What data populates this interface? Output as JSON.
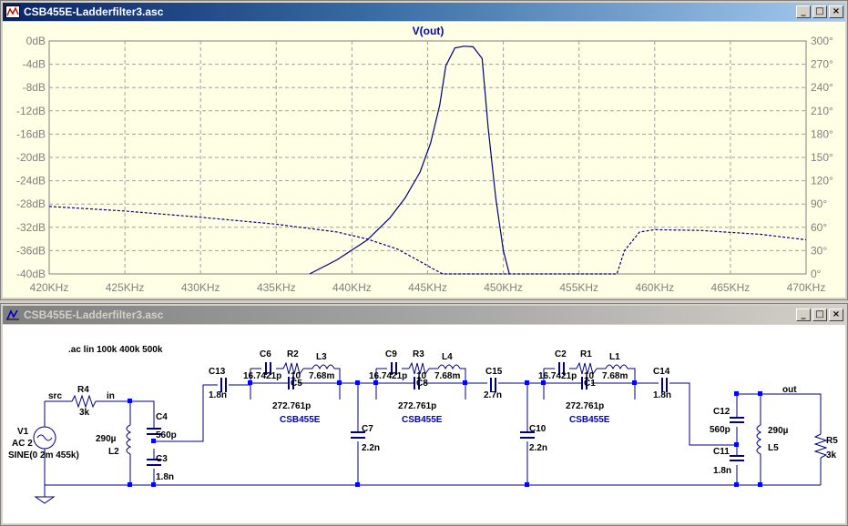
{
  "plot_window": {
    "title": "CSB455E-Ladderfilter3.asc",
    "trace_label": "V(out)",
    "left_ticks": [
      "0dB",
      "-4dB",
      "-8dB",
      "-12dB",
      "-16dB",
      "-20dB",
      "-24dB",
      "-28dB",
      "-32dB",
      "-36dB",
      "-40dB"
    ],
    "right_ticks": [
      "300°",
      "270°",
      "240°",
      "210°",
      "180°",
      "150°",
      "120°",
      "90°",
      "60°",
      "30°",
      "0°"
    ],
    "x_ticks": [
      "420KHz",
      "425KHz",
      "430KHz",
      "435KHz",
      "440KHz",
      "445KHz",
      "450KHz",
      "455KHz",
      "460KHz",
      "465KHz",
      "470KHz"
    ]
  },
  "schematic_window": {
    "title": "CSB455E-Ladderfilter3.asc",
    "directive": ".ac lin 100k 400k 500k",
    "labels": {
      "src_net": "src",
      "in_net": "in",
      "out_net": "out",
      "v1_name": "V1",
      "v1_ac": "AC 2",
      "v1_sine": "SINE(0 2m 455k)",
      "r4_name": "R4",
      "r4_val": "3k",
      "l2_name": "L2",
      "l2_val": "290µ",
      "c4_name": "C4",
      "c4_val": "560p",
      "c3_name": "C3",
      "c3_val": "1.8n",
      "c13_name": "C13",
      "c13_val": "1.8n",
      "c6_name": "C6",
      "c6_val": "16.7421p",
      "r2_name": "R2",
      "r2_val": "10",
      "l3_name": "L3",
      "l3_val": "7.68m",
      "c5_name": "C5",
      "c5_val": "272.761p",
      "x1": "CSB455E",
      "c7_name": "C7",
      "c7_val": "2.2n",
      "c9_name": "C9",
      "c9_val": "16.7421p",
      "r3_name": "R3",
      "r3_val": "10",
      "l4_name": "L4",
      "l4_val": "7.68m",
      "c8_name": "C8",
      "c8_val": "272.761p",
      "x2": "CSB455E",
      "c15_name": "C15",
      "c15_val": "2.7n",
      "c10_name": "C10",
      "c10_val": "2.2n",
      "c2_name": "C2",
      "c2_val": "16.7421p",
      "r1_name": "R1",
      "r1_val": "10",
      "l1_name": "L1",
      "l1_val": "7.68m",
      "c1_name": "C1",
      "c1_val": "272.761p",
      "x3": "CSB455E",
      "c14_name": "C14",
      "c14_val": "1.8n",
      "c12_name": "C12",
      "c12_val": "560p",
      "c11_name": "C11",
      "c11_val": "1.8n",
      "l5_name": "L5",
      "l5_val": "290µ",
      "r5_name": "R5",
      "r5_val": "3k"
    }
  },
  "chart_data": {
    "type": "line",
    "title": "V(out)",
    "x_unit": "KHz",
    "xlim": [
      420,
      470
    ],
    "ylim": [
      -40,
      0
    ],
    "y2lim": [
      0,
      300
    ],
    "grid": true,
    "series": [
      {
        "name": "V(out)",
        "style": "solid",
        "axis": "left",
        "x": [
          437.2,
          439,
          441,
          442.5,
          443.5,
          444.5,
          445.2,
          445.8,
          446.2,
          446.8,
          447.4,
          448.0,
          448.6,
          449.0,
          449.5,
          450.0,
          450.4
        ],
        "y": [
          -40,
          -37.6,
          -34.2,
          -30.4,
          -27.0,
          -22.5,
          -17.5,
          -11.0,
          -4.3,
          -1.2,
          -0.9,
          -1.0,
          -3.0,
          -15.0,
          -27.0,
          -36.0,
          -40
        ]
      },
      {
        "name": "phase",
        "style": "dashed",
        "axis": "right",
        "x": [
          420,
          425,
          430,
          435,
          439,
          441,
          443,
          444.5,
          445.5,
          446.0,
          457.5,
          458.0,
          459.0,
          460.0,
          463,
          467,
          470
        ],
        "y": [
          87,
          81,
          73,
          64,
          54,
          45,
          32,
          16,
          5,
          0,
          0,
          30,
          54,
          57,
          56,
          51,
          44
        ]
      }
    ]
  }
}
